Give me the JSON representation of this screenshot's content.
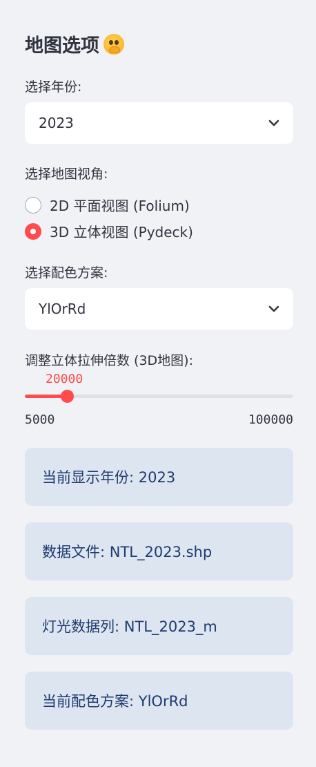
{
  "sidebar": {
    "title": "地图选项",
    "title_emoji": "face-with-hand-over-mouth-emoji",
    "year_select": {
      "label": "选择年份:",
      "value": "2023"
    },
    "view_radio": {
      "label": "选择地图视角:",
      "options": [
        {
          "label": "2D 平面视图 (Folium)",
          "checked": false
        },
        {
          "label": "3D 立体视图 (Pydeck)",
          "checked": true
        }
      ]
    },
    "color_select": {
      "label": "选择配色方案:",
      "value": "YlOrRd"
    },
    "elevation_slider": {
      "label": "调整立体拉伸倍数 (3D地图):",
      "value": "20000",
      "min": "5000",
      "max": "100000"
    },
    "info": [
      "当前显示年份: 2023",
      "数据文件: NTL_2023.shp",
      "灯光数据列: NTL_2023_m",
      "当前配色方案: YlOrRd"
    ]
  },
  "colors": {
    "accent": "#ff4b4b",
    "background": "#f0f2f6",
    "info_bg": "#dde5f1",
    "info_text": "#1e3a6e"
  }
}
